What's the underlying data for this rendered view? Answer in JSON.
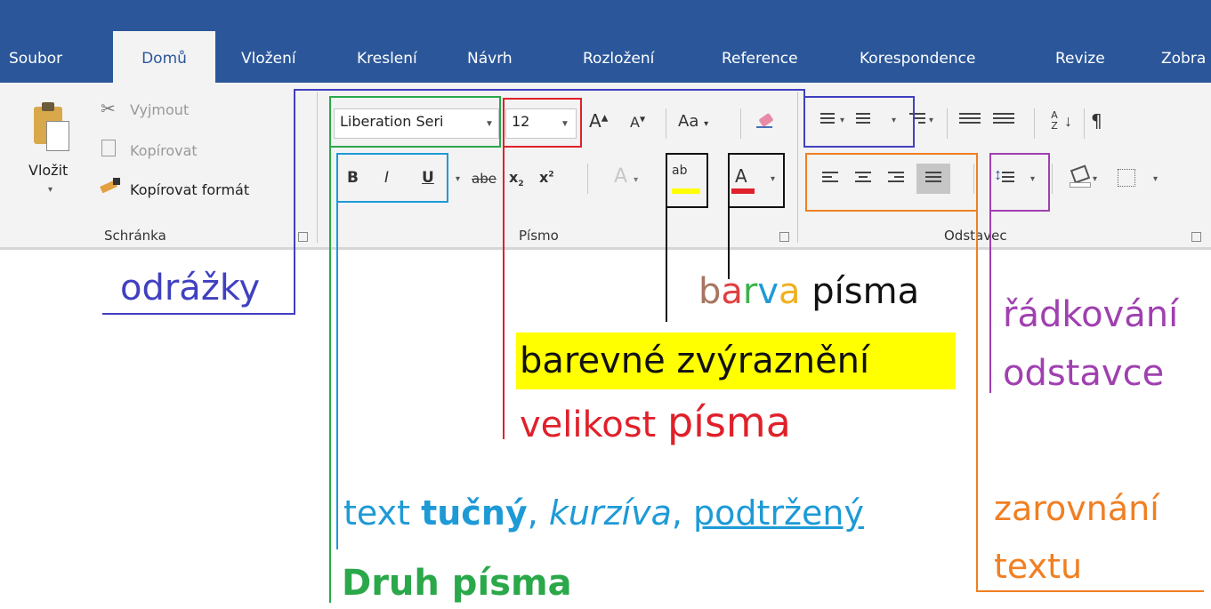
{
  "tabs": [
    "Soubor",
    "Domů",
    "Vložení",
    "Kreslení",
    "Návrh",
    "Rozložení",
    "Reference",
    "Korespondence",
    "Revize",
    "Zobra"
  ],
  "clipboard": {
    "paste_label": "Vložit",
    "cut_label": "Vyjmout",
    "copy_label": "Kopírovat",
    "format_painter_label": "Kopírovat formát",
    "group_label": "Schránka"
  },
  "font": {
    "font_name": "Liberation Seri",
    "font_size": "12",
    "change_case_label": "Aa",
    "group_label": "Písmo",
    "bold": "B",
    "italic": "I",
    "underline": "U",
    "strikethrough": "abe",
    "subscript": "x",
    "superscript": "x",
    "grow": "A",
    "shrink": "A",
    "text_effects": "A",
    "highlight": "ab",
    "font_color": "A"
  },
  "paragraph": {
    "group_label": "Odstavec",
    "sort": "A Z",
    "pilcrow": "¶"
  },
  "annotations": {
    "bullets": "odrážky",
    "font_color_part1": "b",
    "font_color_part2": "a",
    "font_color_part3": "r",
    "font_color_part4": "v",
    "font_color_part5": "a",
    "font_color_word2": "písma",
    "line_spacing_1": "řádkování",
    "line_spacing_2": "odstavce",
    "highlight": "barevné zvýraznění",
    "size_1": "velikost",
    "size_2": "písma",
    "style_text": "text",
    "style_bold": "tučný",
    "style_comma1": ",",
    "style_italic": "kurzíva",
    "style_comma2": ",",
    "style_underline": "podtržený",
    "font_type": "Druh písma",
    "alignment_1": "zarovnání",
    "alignment_2": "textu"
  },
  "colors": {
    "tabbar": "#2b579a",
    "ribbon": "#f3f3f3",
    "bullets": "#4040c0",
    "font_type": "#2aa84a",
    "style": "#1e9ad6",
    "size": "#e0202a",
    "highlight_bg": "#ffff00",
    "line_spacing": "#a040b0",
    "alignment": "#f07f22"
  }
}
